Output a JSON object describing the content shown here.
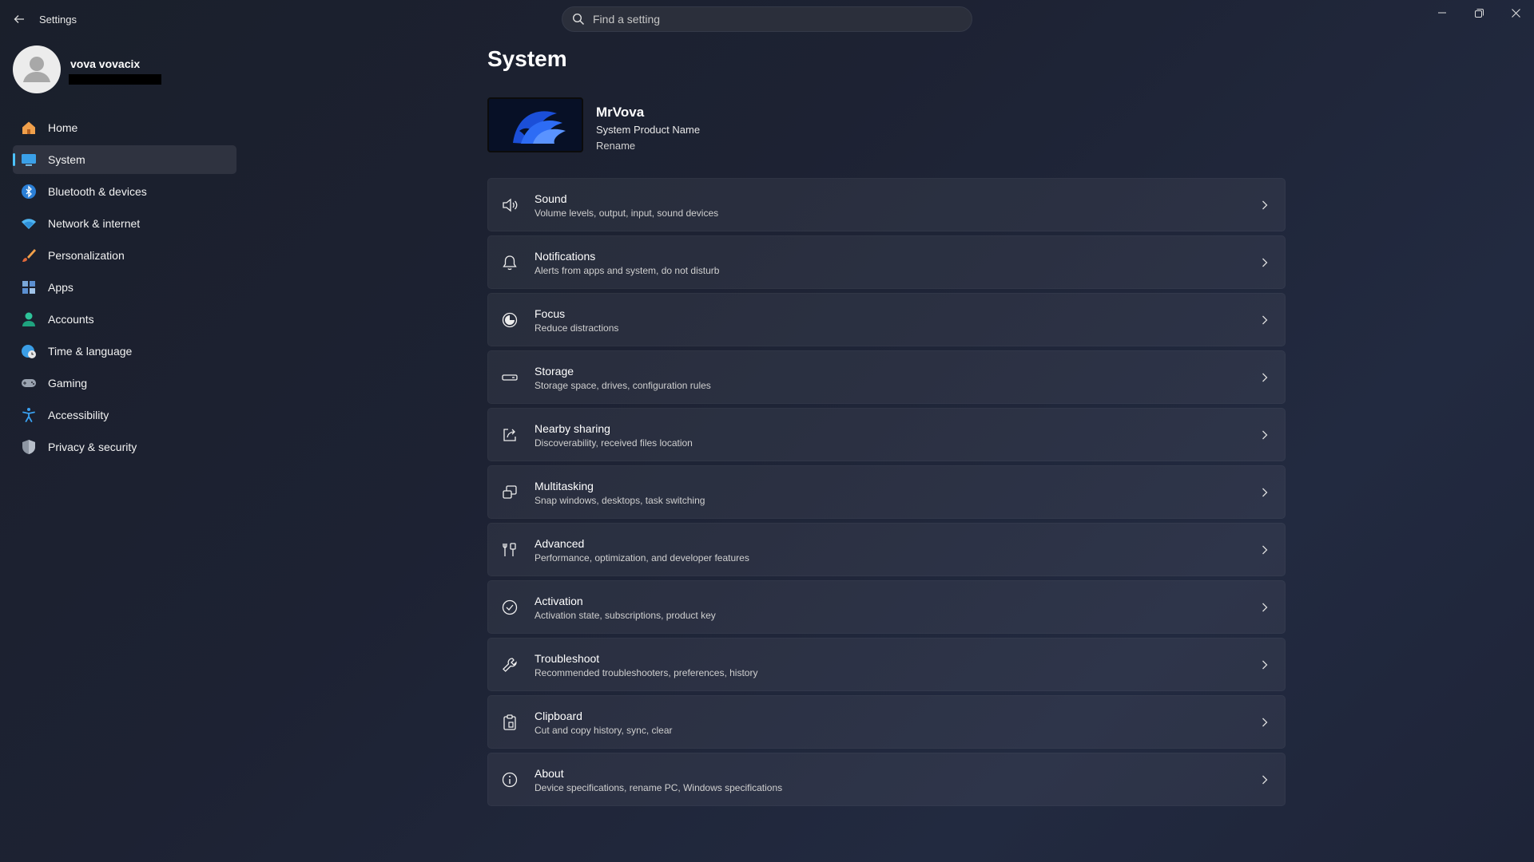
{
  "app": {
    "title": "Settings"
  },
  "search": {
    "placeholder": "Find a setting"
  },
  "profile": {
    "name": "vova vovacix"
  },
  "sidebar": {
    "items": [
      {
        "label": "Home",
        "icon": "home-icon"
      },
      {
        "label": "System",
        "icon": "monitor-icon",
        "active": true
      },
      {
        "label": "Bluetooth & devices",
        "icon": "bluetooth-icon"
      },
      {
        "label": "Network & internet",
        "icon": "wifi-icon"
      },
      {
        "label": "Personalization",
        "icon": "brush-icon"
      },
      {
        "label": "Apps",
        "icon": "apps-icon"
      },
      {
        "label": "Accounts",
        "icon": "person-icon"
      },
      {
        "label": "Time & language",
        "icon": "globe-clock-icon"
      },
      {
        "label": "Gaming",
        "icon": "gamepad-icon"
      },
      {
        "label": "Accessibility",
        "icon": "accessibility-icon"
      },
      {
        "label": "Privacy & security",
        "icon": "shield-icon"
      }
    ]
  },
  "main": {
    "title": "System",
    "device": {
      "name": "MrVova",
      "product": "System Product Name",
      "rename": "Rename"
    },
    "cards": [
      {
        "title": "Sound",
        "subtitle": "Volume levels, output, input, sound devices",
        "icon": "speaker-icon"
      },
      {
        "title": "Notifications",
        "subtitle": "Alerts from apps and system, do not disturb",
        "icon": "bell-icon"
      },
      {
        "title": "Focus",
        "subtitle": "Reduce distractions",
        "icon": "focus-icon"
      },
      {
        "title": "Storage",
        "subtitle": "Storage space, drives, configuration rules",
        "icon": "drive-icon"
      },
      {
        "title": "Nearby sharing",
        "subtitle": "Discoverability, received files location",
        "icon": "share-icon"
      },
      {
        "title": "Multitasking",
        "subtitle": "Snap windows, desktops, task switching",
        "icon": "multitask-icon"
      },
      {
        "title": "Advanced",
        "subtitle": "Performance, optimization, and developer features",
        "icon": "tools-icon"
      },
      {
        "title": "Activation",
        "subtitle": "Activation state, subscriptions, product key",
        "icon": "check-circle-icon"
      },
      {
        "title": "Troubleshoot",
        "subtitle": "Recommended troubleshooters, preferences, history",
        "icon": "wrench-icon"
      },
      {
        "title": "Clipboard",
        "subtitle": "Cut and copy history, sync, clear",
        "icon": "clipboard-icon"
      },
      {
        "title": "About",
        "subtitle": "Device specifications, rename PC, Windows specifications",
        "icon": "info-icon"
      }
    ]
  },
  "colors": {
    "accent": "#4cc2ff",
    "background": "#1d2233",
    "card": "#2a2f3c"
  }
}
